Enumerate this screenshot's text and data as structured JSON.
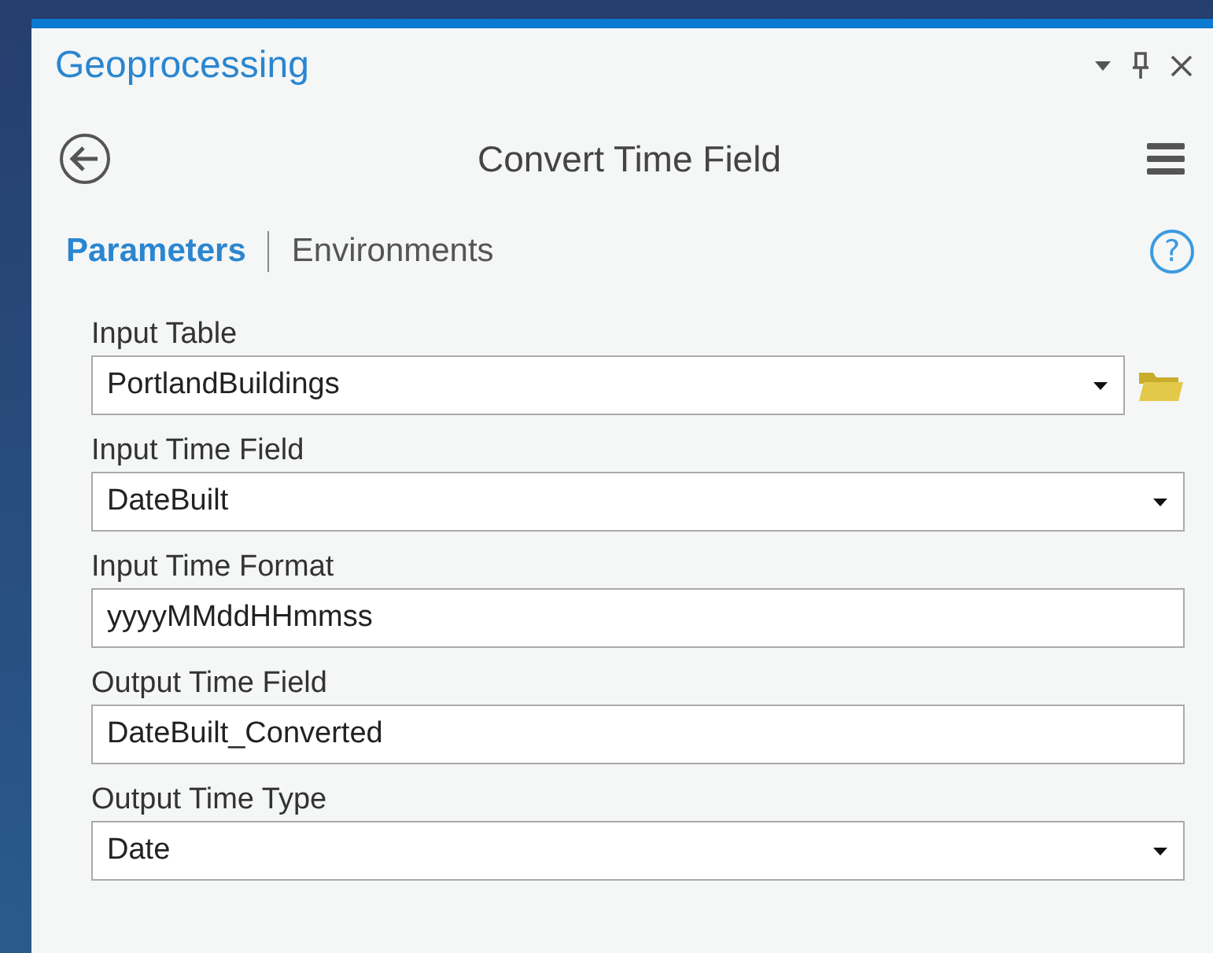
{
  "pane": {
    "title": "Geoprocessing"
  },
  "tool": {
    "title": "Convert Time Field"
  },
  "tabs": [
    {
      "label": "Parameters",
      "selected": true
    },
    {
      "label": "Environments",
      "selected": false
    }
  ],
  "help": {
    "label": "?"
  },
  "parameters": [
    {
      "label": "Input Table",
      "kind": "dropdown",
      "value": "PortlandBuildings",
      "browse": true
    },
    {
      "label": "Input Time Field",
      "kind": "dropdown",
      "value": "DateBuilt",
      "browse": false
    },
    {
      "label": "Input Time Format",
      "kind": "text",
      "value": "yyyyMMddHHmmss",
      "browse": false
    },
    {
      "label": "Output Time Field",
      "kind": "text",
      "value": "DateBuilt_Converted",
      "browse": false
    },
    {
      "label": "Output Time Type",
      "kind": "dropdown",
      "value": "Date",
      "browse": false
    }
  ]
}
